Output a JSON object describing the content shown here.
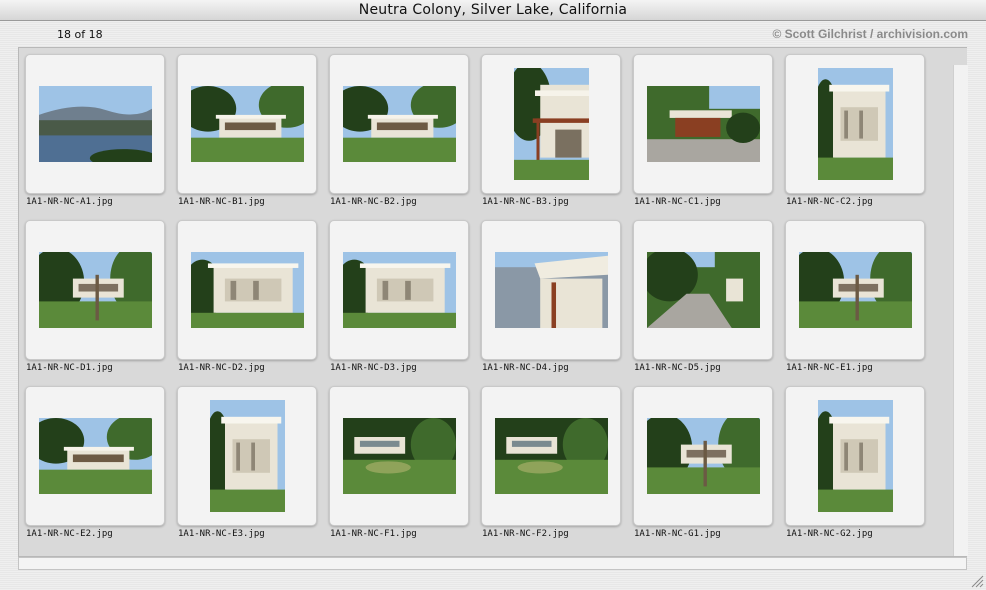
{
  "window": {
    "title": "Neutra Colony, Silver Lake, California",
    "count_label": "18 of 18",
    "copyright": "© Scott Gilchrist / archivision.com"
  },
  "images": [
    {
      "filename": "1A1-NR-NC-A1.jpg",
      "orientation": "landscape",
      "scene": "lake"
    },
    {
      "filename": "1A1-NR-NC-B1.jpg",
      "orientation": "landscape",
      "scene": "house-hillside"
    },
    {
      "filename": "1A1-NR-NC-B2.jpg",
      "orientation": "landscape",
      "scene": "house-hillside"
    },
    {
      "filename": "1A1-NR-NC-B3.jpg",
      "orientation": "portrait",
      "scene": "house-facade-wood"
    },
    {
      "filename": "1A1-NR-NC-C1.jpg",
      "orientation": "landscape",
      "scene": "garage"
    },
    {
      "filename": "1A1-NR-NC-C2.jpg",
      "orientation": "portrait",
      "scene": "house-facade"
    },
    {
      "filename": "1A1-NR-NC-D1.jpg",
      "orientation": "landscape",
      "scene": "house-trees"
    },
    {
      "filename": "1A1-NR-NC-D2.jpg",
      "orientation": "landscape",
      "scene": "house-facade"
    },
    {
      "filename": "1A1-NR-NC-D3.jpg",
      "orientation": "landscape",
      "scene": "house-facade"
    },
    {
      "filename": "1A1-NR-NC-D4.jpg",
      "orientation": "landscape",
      "scene": "house-eaves"
    },
    {
      "filename": "1A1-NR-NC-D5.jpg",
      "orientation": "landscape",
      "scene": "road"
    },
    {
      "filename": "1A1-NR-NC-E1.jpg",
      "orientation": "landscape",
      "scene": "house-trees"
    },
    {
      "filename": "1A1-NR-NC-E2.jpg",
      "orientation": "landscape",
      "scene": "house-hillside"
    },
    {
      "filename": "1A1-NR-NC-E3.jpg",
      "orientation": "portrait",
      "scene": "house-facade"
    },
    {
      "filename": "1A1-NR-NC-F1.jpg",
      "orientation": "landscape",
      "scene": "garden"
    },
    {
      "filename": "1A1-NR-NC-F2.jpg",
      "orientation": "landscape",
      "scene": "garden"
    },
    {
      "filename": "1A1-NR-NC-G1.jpg",
      "orientation": "landscape",
      "scene": "house-trees"
    },
    {
      "filename": "1A1-NR-NC-G2.jpg",
      "orientation": "portrait",
      "scene": "house-facade"
    }
  ],
  "colors": {
    "sky": "#9ec3e6",
    "foliage": "#3f6a2c",
    "foliage_dark": "#23401a",
    "grass": "#5b8a3a",
    "wall": "#e9e4d6",
    "wood": "#8a3f22",
    "water": "#4f6f93",
    "road": "#a9a6a0"
  }
}
